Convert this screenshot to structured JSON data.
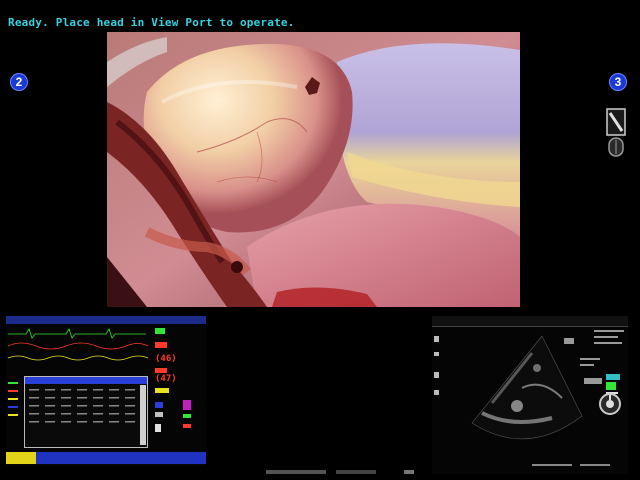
{
  "status": {
    "message": "Ready. Place head in View Port to operate."
  },
  "arms": {
    "left_label": "2",
    "right_label": "3"
  },
  "colors": {
    "status_text": "#38d2e2",
    "badge_fill": "#1a3ad6",
    "monitor_header": "#1c2c8a",
    "hr_green": "#33e633",
    "bp_red": "#ff3a2a",
    "spo2_yellow": "#e8e020"
  },
  "icons": {
    "instrument": "instrument-status-icon",
    "probe_orientation": "probe-orientation-icon"
  },
  "vitals": {
    "bp_mean_1": "(46)",
    "bp_mean_2": "(47)"
  }
}
